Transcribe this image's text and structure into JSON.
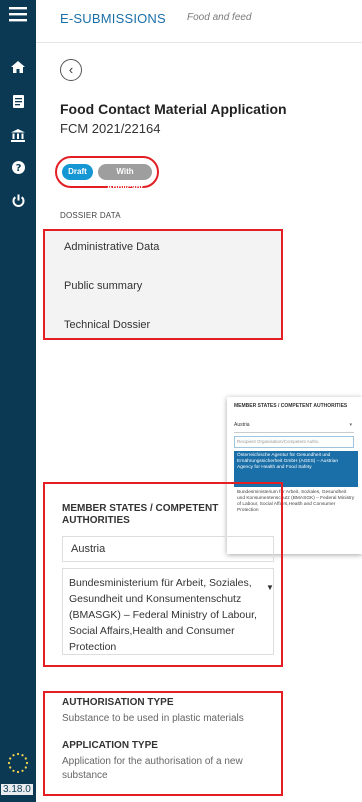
{
  "sidebar": {
    "icons": [
      "menu-icon",
      "home-icon",
      "document-icon",
      "institution-icon",
      "help-icon",
      "power-icon"
    ],
    "version": "3.18.0"
  },
  "header": {
    "brand": "E-SUBMISSIONS",
    "subbrand": "Food and feed"
  },
  "application": {
    "title": "Food Contact Material Application",
    "reference": "FCM 2021/22164",
    "status_badges": [
      "Draft",
      "With Applicant"
    ]
  },
  "dossier": {
    "section_label": "DOSSIER DATA",
    "items": [
      "Administrative Data",
      "Public summary",
      "Technical Dossier"
    ]
  },
  "dropdown_popup": {
    "label": "MEMBER STATES / COMPETENT AUTHORITIES",
    "selected": "Austria",
    "search_placeholder": "Recipient Organisation/Competent Autho",
    "highlighted_option": "Österreichische Agentur für Gesundheit und Ernährungssicherheit GmbH (AGES) – Austrian Agency for Health and Food Safety",
    "other_option": "Bundesministerium für Arbeit, Soziales, Gesundheit und Konsumentenschutz (BMASGK) – Federal Ministry of Labour, Social Affairs,Health and Consumer Protection"
  },
  "member_states": {
    "label": "MEMBER STATES / COMPETENT AUTHORITIES",
    "country": "Austria",
    "authority": "Bundesministerium für Arbeit, Soziales, Gesundheit und Konsumentenschutz (BMASGK) – Federal Ministry of Labour, Social Affairs,Health and Consumer Protection"
  },
  "authorisation": {
    "type_label": "AUTHORISATION TYPE",
    "type_value": "Substance to be used in plastic materials",
    "application_label": "APPLICATION TYPE",
    "application_value": "Application for the authorisation of a new substance"
  },
  "colors": {
    "sidebar": "#0b3954",
    "highlight": "#e31e24",
    "accent": "#1597d4",
    "brand": "#1a6fa8"
  }
}
